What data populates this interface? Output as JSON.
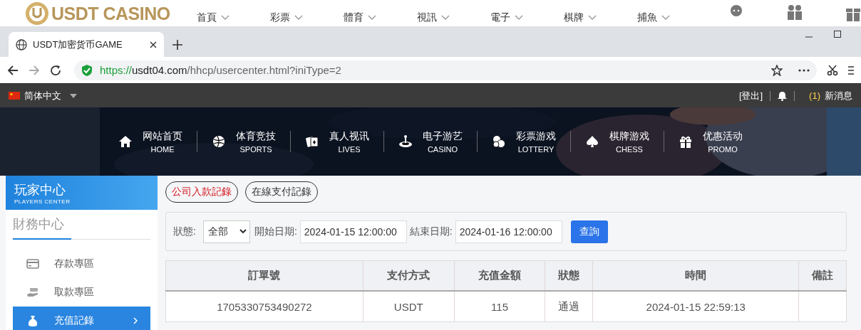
{
  "site_header": {
    "logo": "USDT CASINO",
    "nav": [
      "首頁",
      "彩票",
      "體育",
      "視訊",
      "電子",
      "棋牌",
      "捕魚"
    ]
  },
  "browser": {
    "tab": "USDT加密货币GAME",
    "url_scheme": "https://",
    "url_host": "usdt04.com",
    "url_path": "/hhcp/usercenter.html?iniType=2"
  },
  "topbar": {
    "language": "简体中文",
    "logout": "[登出]",
    "message_count": "(1)",
    "messages": "新消息"
  },
  "main_nav": [
    {
      "title": "网站首页",
      "subtitle": "HOME"
    },
    {
      "title": "体育竞技",
      "subtitle": "SPORTS"
    },
    {
      "title": "真人视讯",
      "subtitle": "LIVES"
    },
    {
      "title": "电子游艺",
      "subtitle": "CASINO"
    },
    {
      "title": "彩票游戏",
      "subtitle": "LOTTERY"
    },
    {
      "title": "棋牌游戏",
      "subtitle": "CHESS"
    },
    {
      "title": "优惠活动",
      "subtitle": "PROMO"
    }
  ],
  "sidebar": {
    "title": "玩家中心",
    "subtitle": "PLAYERS CENTER",
    "section": "財務中心",
    "items": [
      {
        "label": "存款專區",
        "selected": false
      },
      {
        "label": "取款專區",
        "selected": false
      },
      {
        "label": "充值記錄",
        "selected": true
      }
    ]
  },
  "record_tabs": [
    {
      "label": "公司入款記錄",
      "selected": true
    },
    {
      "label": "在線支付記錄",
      "selected": false
    }
  ],
  "filter": {
    "status_label": "狀態:",
    "status_value": "全部",
    "start_label": "開始日期:",
    "start_value": "2024-01-15 12:00:00",
    "end_label": "結束日期:",
    "end_value": "2024-01-16 12:00:00",
    "button": "查詢"
  },
  "table": {
    "columns": [
      "訂單號",
      "支付方式",
      "充值金額",
      "狀態",
      "時間",
      "備註"
    ],
    "rows": [
      {
        "cells": [
          "1705330753490272",
          "USDT",
          "115",
          "通過",
          "2024-01-15 22:59:13"
        ]
      }
    ]
  }
}
